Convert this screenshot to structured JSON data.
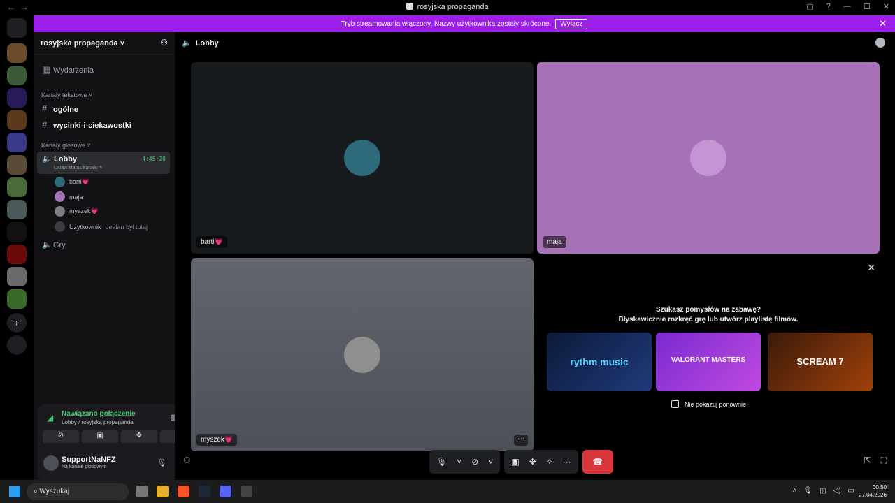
{
  "window": {
    "title": "rosyjska propaganda",
    "back": "←",
    "forward": "→"
  },
  "banner": {
    "text": "Tryb streamowania włączony. Nazwy użytkownika zostały skrócone.",
    "button": "Wyłącz"
  },
  "server": {
    "name": "rosyjska propaganda",
    "events": "Wydarzenia",
    "text_category": "Kanały tekstowe",
    "text_channels": [
      "ogólne",
      "wycinki-i-ciekawostki"
    ],
    "voice_category": "Kanały głosowe",
    "voice_channel": {
      "name": "Lobby",
      "timer": "4:45:20",
      "status": "Ustaw status kanału ✎"
    },
    "members": [
      "barti💗",
      "maja",
      "myszek💗"
    ],
    "ghost_member": {
      "name": "Użytkownik",
      "note": "dealan był tutaj"
    },
    "other_voice": "Gry"
  },
  "voice_panel": {
    "status": "Nawiązano połączenie",
    "location": "Lobby / rosyjska propaganda"
  },
  "user": {
    "name": "SupportNaNFZ",
    "status": "Na kanale głosowym"
  },
  "main": {
    "channel": "Lobby",
    "tiles": [
      {
        "name": "barti💗",
        "bg": "#161a1c"
      },
      {
        "name": "maja",
        "bg": "#a671b7"
      },
      {
        "name": "myszek💗",
        "bg": "#5a5d66"
      }
    ],
    "promo": {
      "line1": "Szukasz pomysłów na zabawę?",
      "line2": "Błyskawicznie rozkręć grę lub utwórz playlistę filmów.",
      "cards": [
        "rythm music",
        "VALORANT MASTERS",
        "SCREAM 7"
      ],
      "checkbox": "Nie pokazuj ponownie"
    }
  },
  "taskbar": {
    "search": "Wyszukaj",
    "time": "00:50",
    "date": "27.04.2026"
  },
  "colors": {
    "accent": "#9b1fe8",
    "connected": "#44c877",
    "hangup": "#da373c"
  }
}
